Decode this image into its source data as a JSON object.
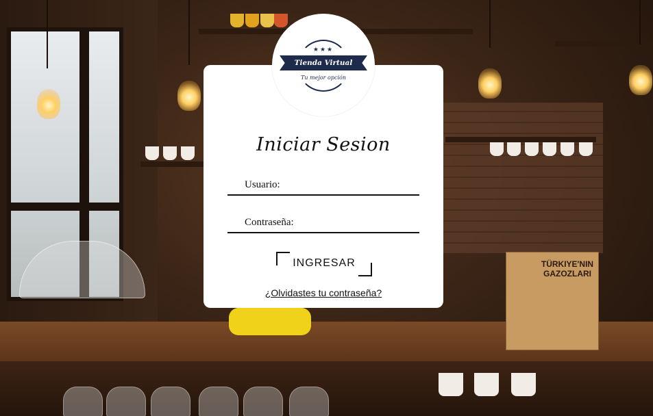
{
  "logo": {
    "brand": "Tienda Virtual",
    "tagline": "Tu mejor opción",
    "stars": "★★★",
    "color": "#1f2b4d"
  },
  "login": {
    "title": "Iniciar Sesion",
    "username_label": "Usuario:",
    "password_label": "Contraseña:",
    "submit_label": "INGRESAR",
    "forgot_link": "¿Olvidastes tu contraseña?"
  },
  "background": {
    "crate_text": "TÜRKIYE'NIN GAZOZLARI"
  }
}
